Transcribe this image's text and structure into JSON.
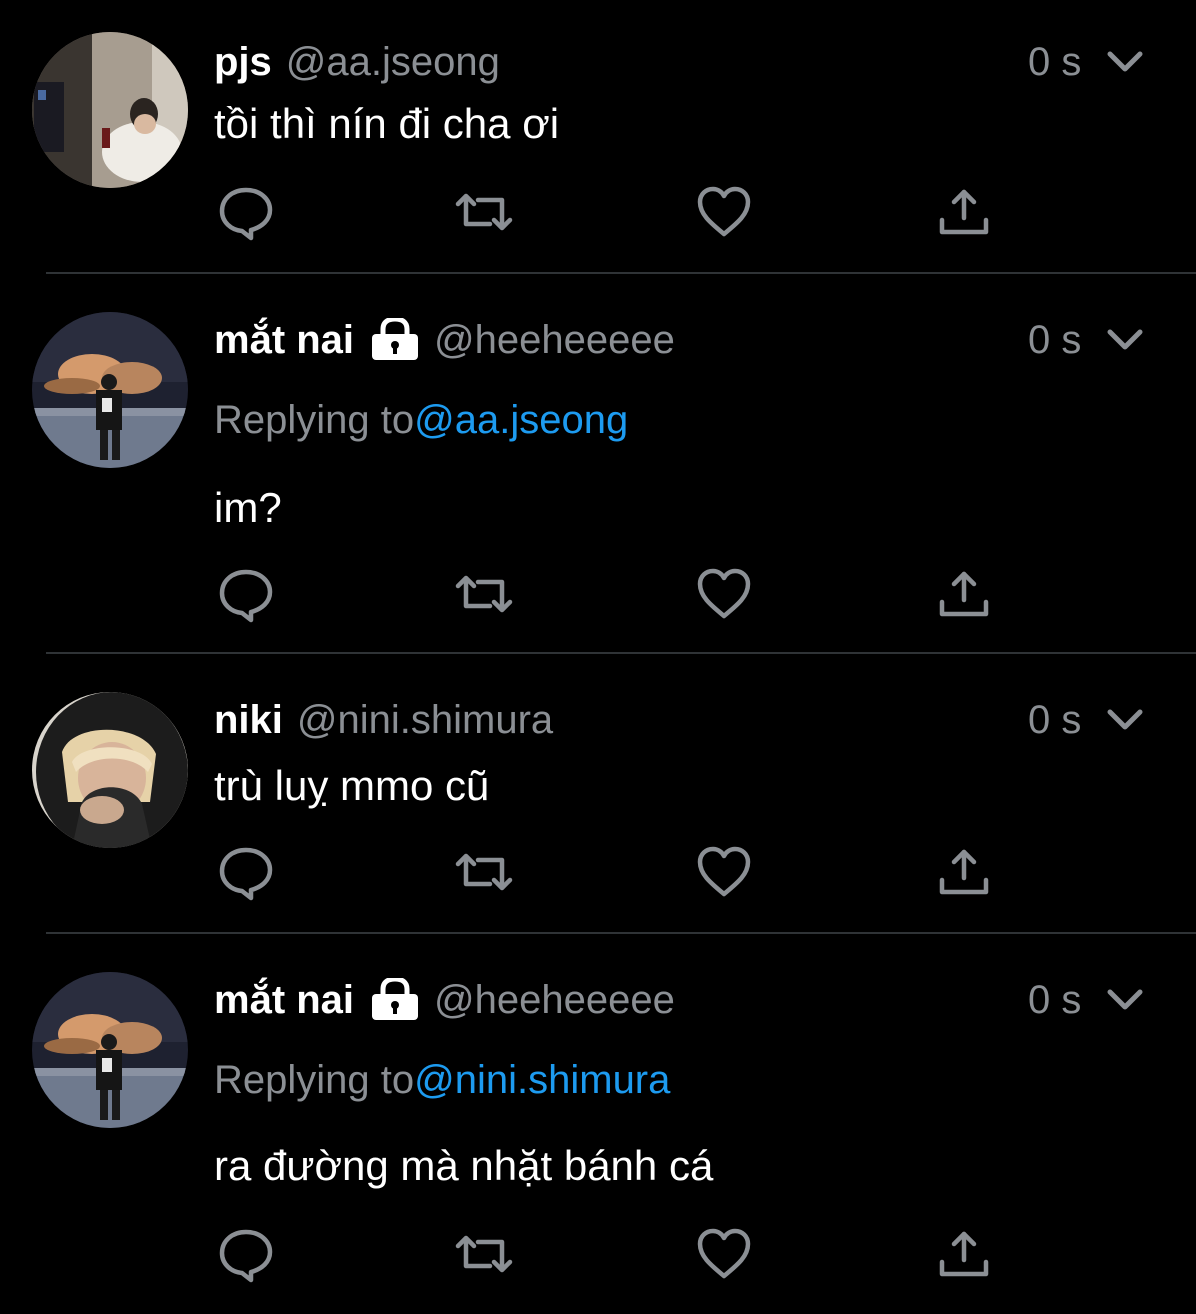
{
  "colors": {
    "background": "#000000",
    "text_primary": "#ffffff",
    "text_secondary": "#8b8f94",
    "mention": "#1d9bf0",
    "divider": "#2f3336"
  },
  "tweets": [
    {
      "display_name": "pjs",
      "handle": "@aa.jseong",
      "locked": false,
      "time": "0 s",
      "reply_prefix": "",
      "reply_mention": "",
      "text": "tồi thì nín đi cha ơi",
      "icons": [
        "reply-icon",
        "retweet-icon",
        "like-icon",
        "share-icon"
      ]
    },
    {
      "display_name": "mắt nai",
      "handle": "@heeheeeee",
      "locked": true,
      "time": "0 s",
      "reply_prefix": "Replying to",
      "reply_mention": "@aa.jseong",
      "text": "im?",
      "icons": [
        "reply-icon",
        "retweet-icon",
        "like-icon",
        "share-icon"
      ]
    },
    {
      "display_name": "niki",
      "handle": "@nini.shimura",
      "locked": false,
      "time": "0 s",
      "reply_prefix": "",
      "reply_mention": "",
      "text": "trù luỵ mmo cũ",
      "icons": [
        "reply-icon",
        "retweet-icon",
        "like-icon",
        "share-icon"
      ]
    },
    {
      "display_name": "mắt nai",
      "handle": "@heeheeeee",
      "locked": true,
      "time": "0 s",
      "reply_prefix": "Replying to",
      "reply_mention": "@nini.shimura",
      "text": "ra đường mà nhặt bánh cá",
      "icons": [
        "reply-icon",
        "retweet-icon",
        "like-icon",
        "share-icon"
      ]
    }
  ]
}
